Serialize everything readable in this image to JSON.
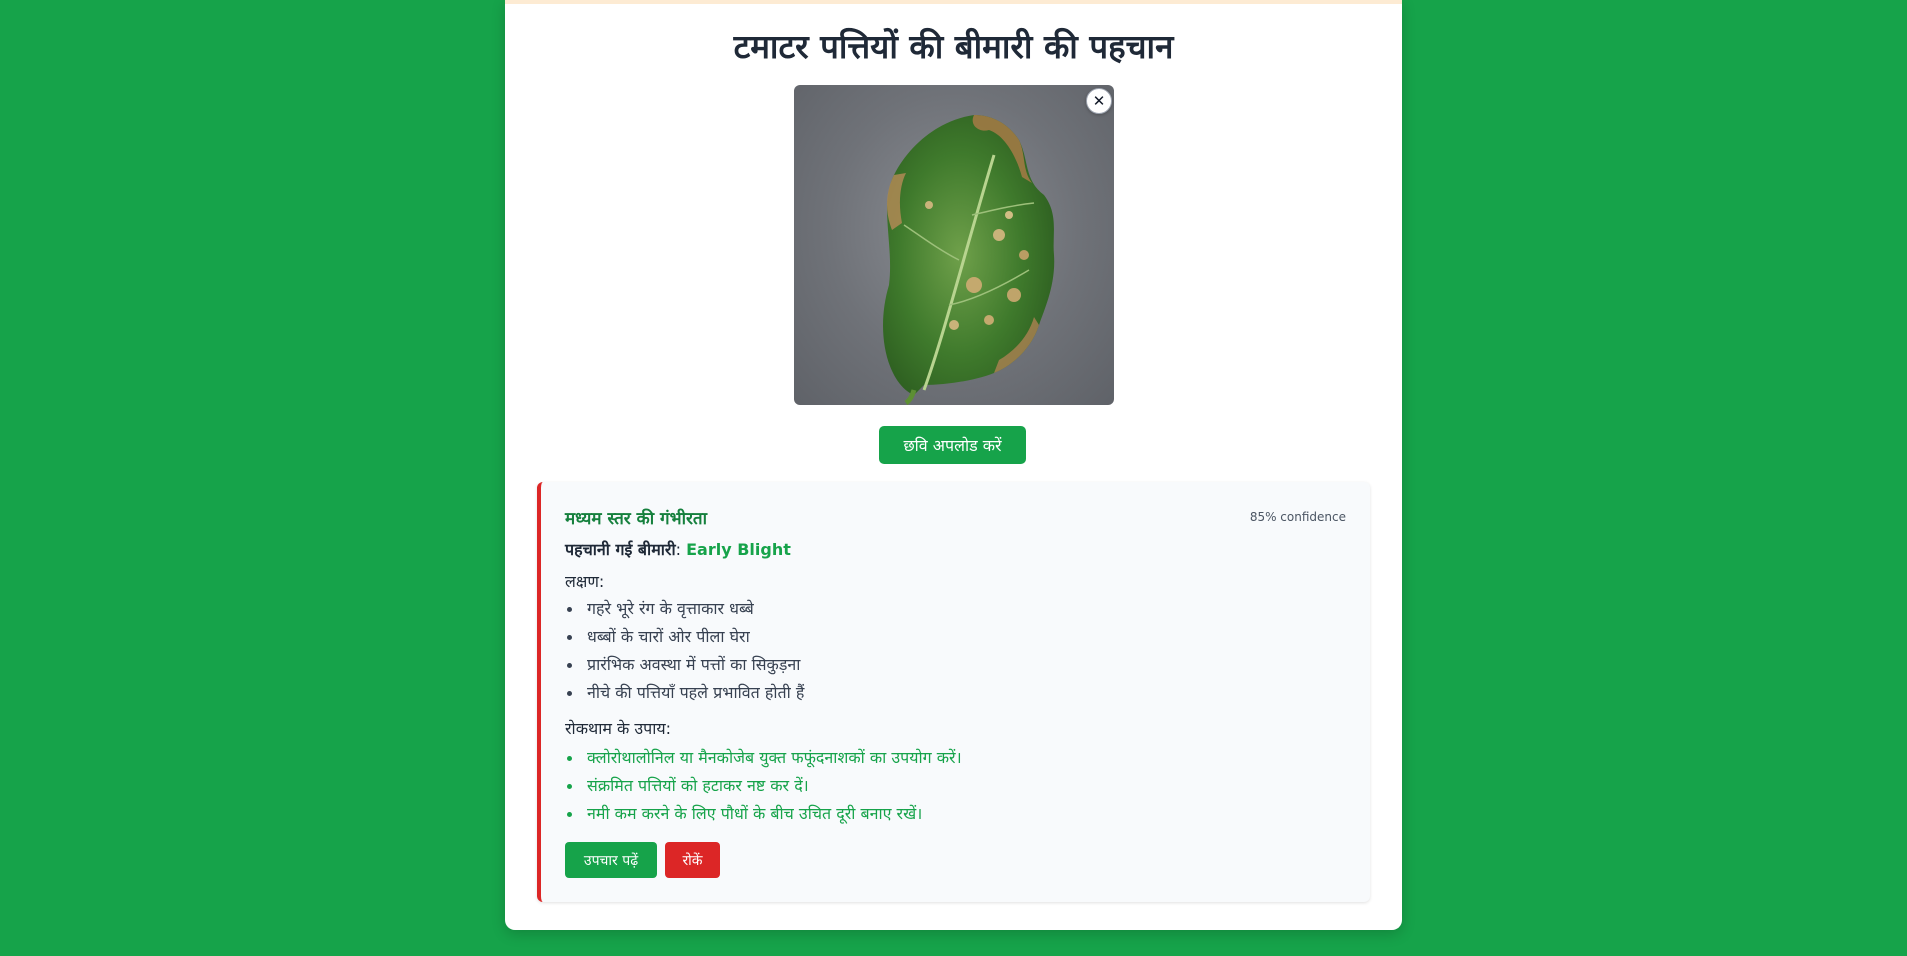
{
  "page": {
    "title": "टमाटर पत्तियों की बीमारी की पहचान",
    "close_symbol": "✕"
  },
  "upload": {
    "label": "छवि अपलोड करें"
  },
  "result": {
    "severity": "मध्यम स्तर की गंभीरता",
    "confidence": "85% confidence",
    "disease_label": "पहचानी गई बीमारी",
    "disease_sep": ":",
    "disease_name": "Early Blight",
    "symptoms_label": "लक्षण:",
    "symptoms": [
      "गहरे भूरे रंग के वृत्ताकार धब्बे",
      "धब्बों के चारों ओर पीला घेरा",
      "प्रारंभिक अवस्था में पत्तों का सिकुड़ना",
      "नीचे की पत्तियाँ पहले प्रभावित होती हैं"
    ],
    "prevention_label": "रोकथाम के उपाय:",
    "prevention": [
      "क्लोरोथालोनिल या मैनकोजेब युक्त फफूंदनाशकों का उपयोग करें।",
      "संक्रमित पत्तियों को हटाकर नष्ट कर दें।",
      "नमी कम करने के लिए पौधों के बीच उचित दूरी बनाए रखें।"
    ],
    "read_button": "उपचार पढ़ें",
    "stop_button": "रोकें"
  },
  "colors": {
    "background": "#16a34a",
    "accent_green": "#16a34a",
    "danger_red": "#dc2626"
  }
}
